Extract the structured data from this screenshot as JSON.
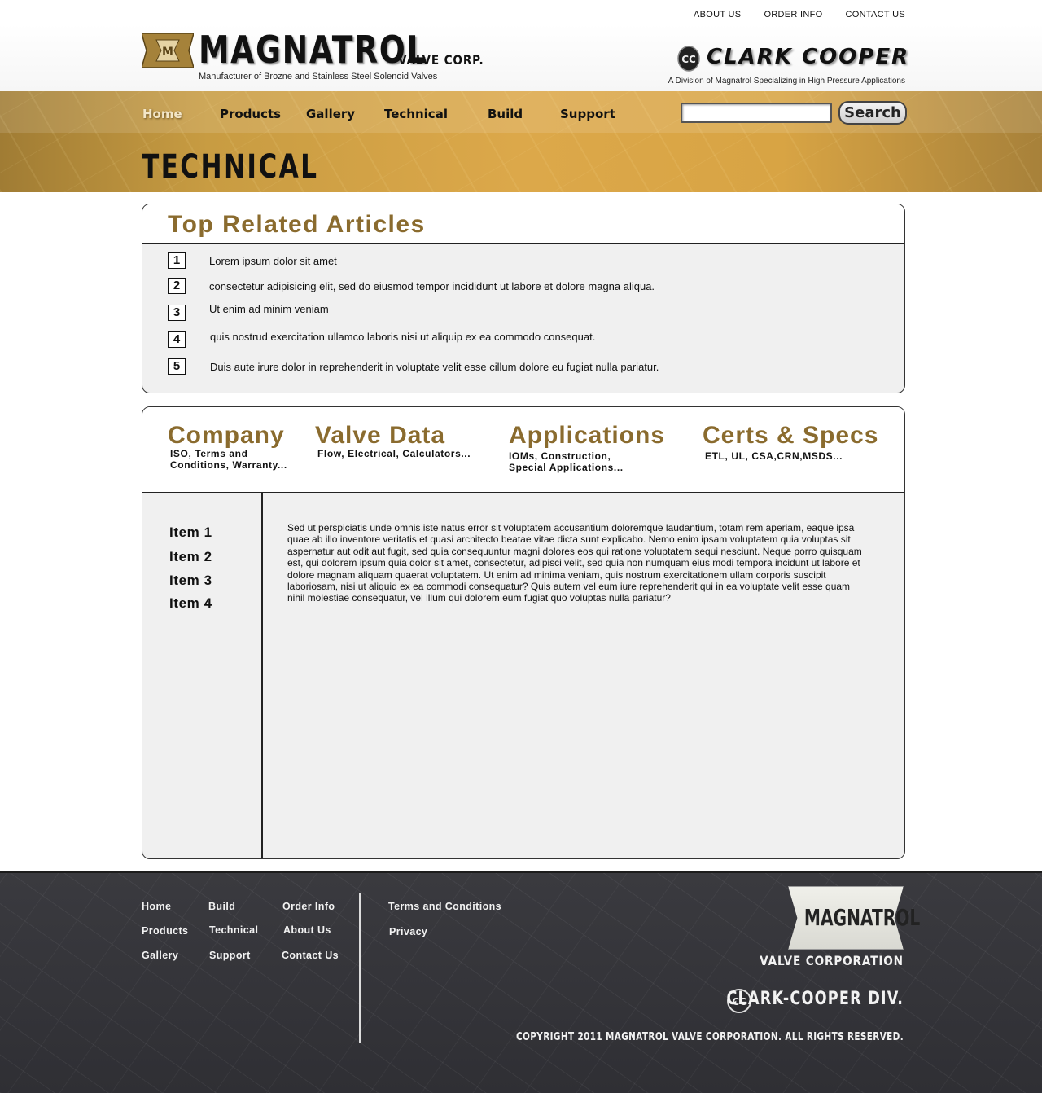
{
  "top_links": [
    "ABOUT US",
    "ORDER INFO",
    "CONTACT US"
  ],
  "brand": {
    "name": "MAGNATROL",
    "suffix": "VALVE CORP.",
    "tagline": "Manufacturer of Brozne and Stainless Steel Solenoid Valves",
    "division_name": "CLARK COOPER",
    "division_tagline": "A Division of Magnatrol Specializing in High Pressure Applications"
  },
  "nav": {
    "items": [
      "Home",
      "Products",
      "Gallery",
      "Technical",
      "Build",
      "Support"
    ],
    "active": "Home",
    "search_button": "Search",
    "search_value": ""
  },
  "page_title": "TECHNICAL",
  "articles": {
    "heading": "Top Related Articles",
    "items": [
      {
        "num": "1",
        "text": "Lorem ipsum dolor sit amet"
      },
      {
        "num": "2",
        "text": "consectetur adipisicing elit, sed do eiusmod tempor incididunt ut labore et dolore magna aliqua."
      },
      {
        "num": "3",
        "text": "Ut enim ad minim veniam"
      },
      {
        "num": "4",
        "text": "quis nostrud exercitation ullamco laboris nisi ut aliquip ex ea commodo consequat."
      },
      {
        "num": "5",
        "text": "Duis aute irure dolor in reprehenderit in voluptate velit esse cillum dolore eu fugiat nulla pariatur."
      }
    ]
  },
  "categories": [
    {
      "title": "Company",
      "subtitle_lines": [
        "ISO, Terms and",
        "Conditions, Warranty..."
      ]
    },
    {
      "title": "Valve Data",
      "subtitle_lines": [
        "Flow, Electrical, Calculators..."
      ]
    },
    {
      "title": "Applications",
      "subtitle_lines": [
        "IOMs, Construction,",
        "Special Applications..."
      ]
    },
    {
      "title": "Certs & Specs",
      "subtitle_lines": [
        "ETL, UL, CSA,CRN,MSDS..."
      ]
    }
  ],
  "sidebar": [
    "Item 1",
    "Item 2",
    "Item 3",
    "Item 4"
  ],
  "body_text": "Sed ut perspiciatis unde omnis iste natus error sit voluptatem accusantium doloremque laudantium, totam rem aperiam, eaque ipsa quae ab illo inventore veritatis et quasi architecto beatae vitae dicta sunt explicabo. Nemo enim ipsam voluptatem quia voluptas sit aspernatur aut odit aut fugit, sed quia consequuntur magni dolores eos qui ratione voluptatem sequi nesciunt. Neque porro quisquam est, qui dolorem ipsum quia dolor sit amet, consectetur, adipisci velit, sed quia non numquam eius modi tempora incidunt ut labore et dolore magnam aliquam quaerat voluptatem. Ut enim ad minima veniam, quis nostrum exercitationem ullam corporis suscipit laboriosam, nisi ut aliquid ex ea commodi consequatur? Quis autem vel eum iure reprehenderit qui in ea voluptate velit esse quam nihil molestiae consequatur, vel illum qui dolorem eum fugiat quo voluptas nulla pariatur?",
  "footer": {
    "col1": [
      "Home",
      "Products",
      "Gallery"
    ],
    "col2": [
      "Build",
      "Technical",
      "Support"
    ],
    "col3": [
      "Order Info",
      "About Us",
      "Contact Us"
    ],
    "col4": [
      "Terms and Conditions",
      "Privacy"
    ],
    "logo_text": "MAGNATROL",
    "logo_sub": "VALVE CORPORATION",
    "division": "CLARK-COOPER DIV.",
    "copyright": "COPYRIGHT 2011 MAGNATROL VALVE CORPORATION. ALL RIGHTS RESERVED."
  },
  "colors": {
    "accent_gold": "#8a6b2e",
    "nav_band": "#dca84a",
    "footer_bg": "#35353a"
  }
}
